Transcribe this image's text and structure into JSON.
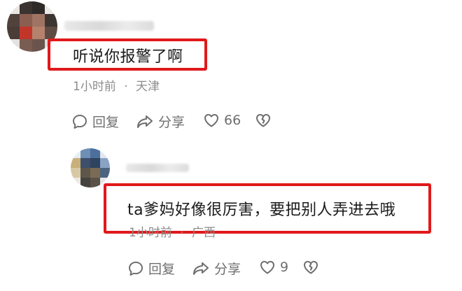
{
  "comments": [
    {
      "text": "听说你报警了啊",
      "time": "1小时前",
      "separator": "·",
      "location": "天津",
      "actions": {
        "reply_label": "回复",
        "share_label": "分享",
        "like_count": "66"
      }
    },
    {
      "text": "ta爹妈好像很厉害，要把别人弄进去哦",
      "time": "1小时前",
      "separator": "·",
      "location": "广西",
      "actions": {
        "reply_label": "回复",
        "share_label": "分享",
        "like_count": "9"
      }
    }
  ],
  "icons": {
    "reply": "comment-bubble-icon",
    "share": "share-arrow-icon",
    "like": "heart-icon",
    "dislike": "broken-heart-icon"
  },
  "colors": {
    "highlight": "#e0191b",
    "meta_text": "#8c8c8c",
    "action_text": "#6f6f6f"
  }
}
